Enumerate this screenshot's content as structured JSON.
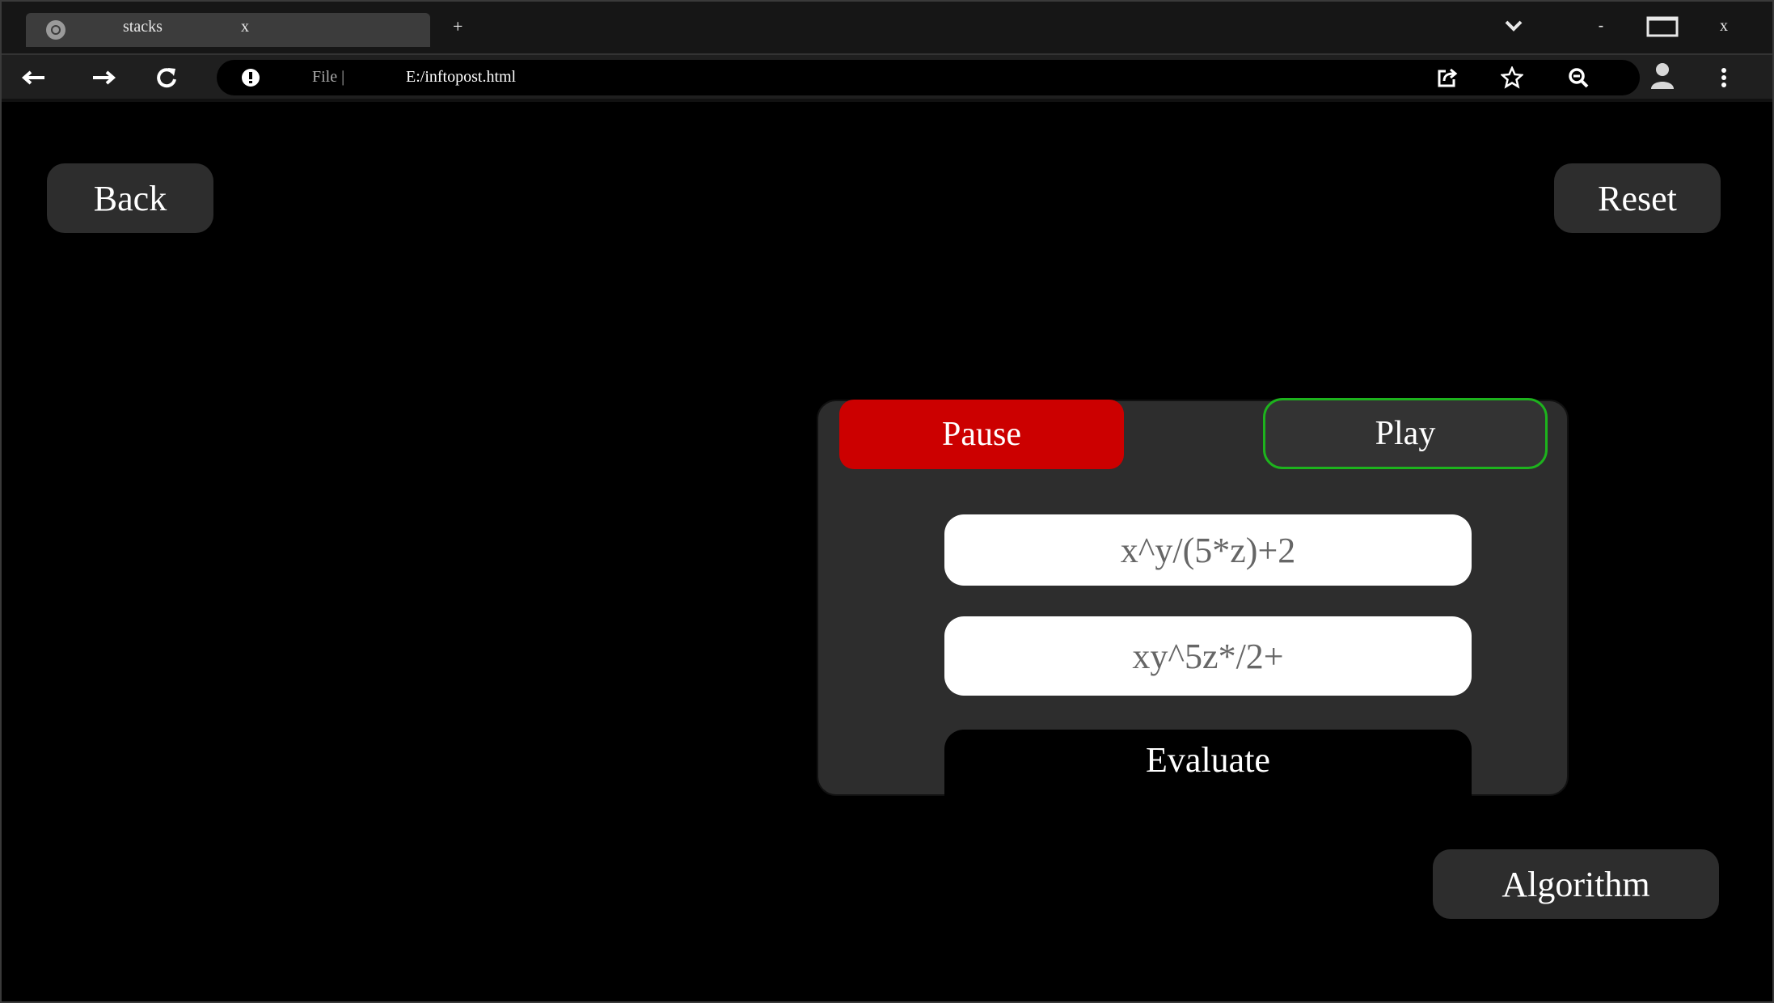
{
  "browser": {
    "tab_title": "stacks",
    "tab_close": "x",
    "new_tab": "+",
    "minimize": "-",
    "close": "x",
    "file_label": "File |",
    "url": "E:/inftopost.html"
  },
  "page": {
    "back_label": "Back",
    "reset_label": "Reset",
    "algorithm_label": "Algorithm"
  },
  "panel": {
    "pause_label": "Pause",
    "play_label": "Play",
    "infix_value": "x^y/(5*z)+2",
    "postfix_value": "xy^5z*/2+",
    "evaluate_label": "Evaluate"
  },
  "colors": {
    "background": "#000000",
    "panel": "#2d2d2d",
    "pause": "#cc0000",
    "play_border": "#1db31d"
  }
}
